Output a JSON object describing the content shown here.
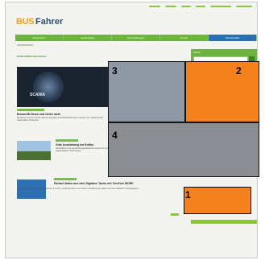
{
  "site": {
    "logo_part1": "BUS",
    "logo_part2": "Fahrer"
  },
  "nav": {
    "items": [
      {
        "label": "Nachrichten"
      },
      {
        "label": "Fachbeiträge"
      },
      {
        "label": "Veranstaltungen"
      },
      {
        "label": "Firmen"
      },
      {
        "label": "Fahrerbedarf",
        "active": true
      }
    ]
  },
  "main": {
    "section_title": "BUSFAHRER Nachrichten",
    "hero_brand": "SCANIA",
    "articles": [
      {
        "title": "BusworlD-News und vieles mehr",
        "text": "Mit dieser Themen für die nächste Ausgabe finde BUSFahrer das neueste neue Nachricht der dargestellten Busworld..."
      },
      {
        "title": "Gute Ausstattung bei Erdlko",
        "text": "Die Erdlko Firma hat die Busgesellschaft erneuert mit gut ausgestatteten Fahrzeugen."
      },
      {
        "title": "Einfach Daten aus dem Digitalen Tacho mit TomTom WORK",
        "text": "Ab sofort ist es möglich, Informationen zu Lenk- und Ruhezeiten von Fahrern auf Basis der Daten aus dem Digitalen Tachographen..."
      }
    ]
  },
  "sidebar": {
    "search_title": "Suche"
  },
  "overlays": [
    {
      "num": "1",
      "color": "#f5821f"
    },
    {
      "num": "2",
      "color": "#f5821f"
    },
    {
      "num": "3",
      "color": "#8f99a5"
    },
    {
      "num": "4",
      "color": "#8a8d92"
    }
  ]
}
